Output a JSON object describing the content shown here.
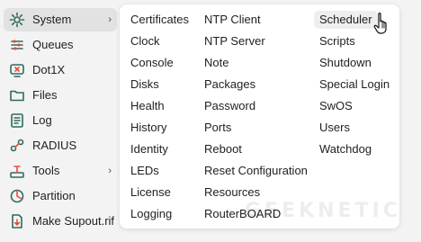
{
  "sidebar": {
    "items": [
      {
        "label": "System",
        "icon": "gear-icon",
        "active": true,
        "submenu": true
      },
      {
        "label": "Queues",
        "icon": "queues-icon"
      },
      {
        "label": "Dot1X",
        "icon": "dot1x-icon"
      },
      {
        "label": "Files",
        "icon": "folder-icon"
      },
      {
        "label": "Log",
        "icon": "log-icon"
      },
      {
        "label": "RADIUS",
        "icon": "radius-icon"
      },
      {
        "label": "Tools",
        "icon": "tools-icon",
        "submenu": true
      },
      {
        "label": "Partition",
        "icon": "partition-icon"
      },
      {
        "label": "Make Supout.rif",
        "icon": "supout-icon"
      }
    ],
    "chevron": "›"
  },
  "system_menu": {
    "col1": [
      "Certificates",
      "Clock",
      "Console",
      "Disks",
      "Health",
      "History",
      "Identity",
      "LEDs",
      "License",
      "Logging"
    ],
    "col2": [
      "NTP Client",
      "NTP Server",
      "Note",
      "Packages",
      "Password",
      "Ports",
      "Reboot",
      "Reset Configuration",
      "Resources",
      "RouterBOARD"
    ],
    "col3": [
      "Scheduler",
      "Scripts",
      "Shutdown",
      "Special Login",
      "SwOS",
      "Users",
      "Watchdog"
    ],
    "hovered": "Scheduler"
  },
  "watermark": "GEEKNETIC",
  "colors": {
    "background": "#f3f3f3",
    "menu_bg": "#ffffff",
    "active_bg": "#e2e2e2",
    "hover_bg": "#eeeeee"
  }
}
